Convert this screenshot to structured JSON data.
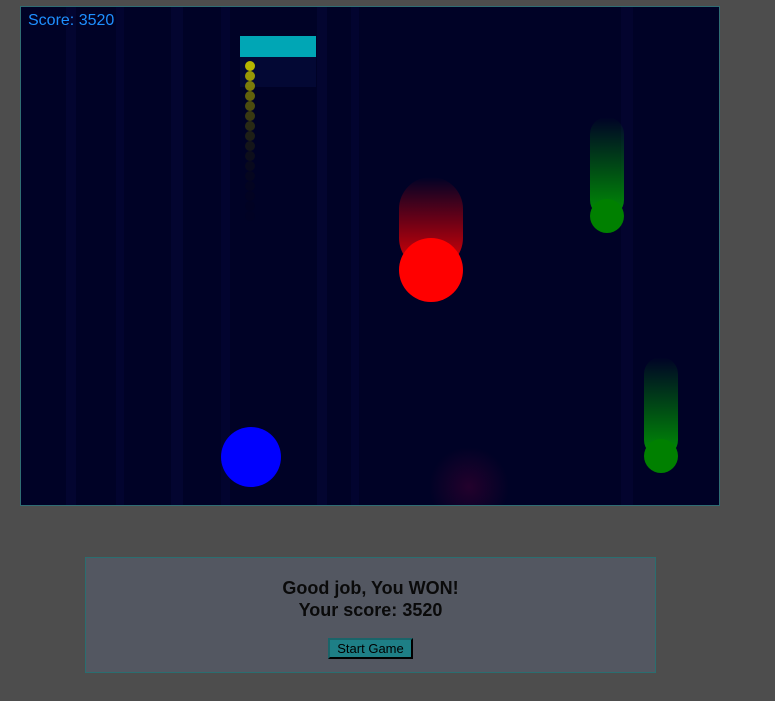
{
  "hud": {
    "score_label": "Score:",
    "score_value": "3520"
  },
  "game_over_panel": {
    "message": "Good job, You WON!",
    "score_prefix": "Your score:",
    "score_value": "3520",
    "start_button_label": "Start Game"
  },
  "colors": {
    "background": "#4d4d4d",
    "playfield": "#000226",
    "score_text": "#1e90ff",
    "paddle": "#00a6b5",
    "player_ball": "#0000ff",
    "enemy_ball": "#ff0000",
    "bonus_ball": "#008000",
    "projectile_trail": "#b5b500",
    "panel": "#535761",
    "button": "#1e7f86"
  },
  "entities": {
    "paddle": {
      "type": "paddle",
      "icon": "paddle-icon"
    },
    "player_ball": {
      "type": "player",
      "icon": "blue-ball-icon"
    },
    "enemy_ball": {
      "type": "enemy",
      "icon": "red-ball-icon"
    },
    "bonus_balls": [
      {
        "type": "bonus",
        "icon": "green-ball-icon"
      },
      {
        "type": "bonus",
        "icon": "green-ball-icon"
      }
    ],
    "projectile_trail": {
      "type": "projectile",
      "icon": "yellow-dot-trail-icon"
    }
  }
}
